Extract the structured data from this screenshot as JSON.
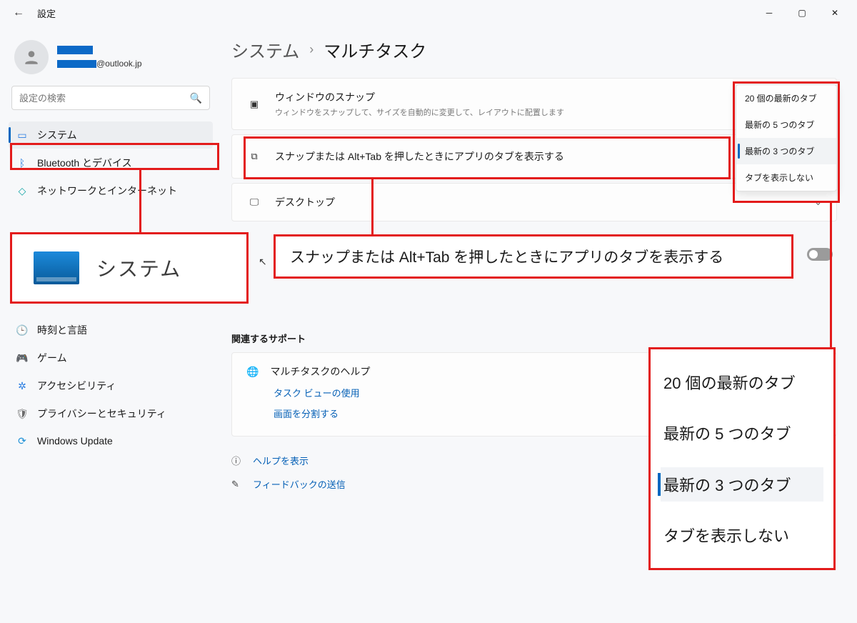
{
  "window": {
    "title": "設定"
  },
  "profile": {
    "email_suffix": "@outlook.jp"
  },
  "search": {
    "placeholder": "設定の検索"
  },
  "sidebar": {
    "items": [
      {
        "label": "システム",
        "icon": "💻",
        "cls": "i-blue"
      },
      {
        "label": "Bluetooth とデバイス",
        "icon": "ᛒ",
        "cls": "i-blue"
      },
      {
        "label": "ネットワークとインターネット",
        "icon": "◆",
        "cls": "i-teal"
      },
      {
        "label": "時刻と言語",
        "icon": "🕒",
        "cls": "i-ora"
      },
      {
        "label": "ゲーム",
        "icon": "🎮",
        "cls": "i-gray"
      },
      {
        "label": "アクセシビリティ",
        "icon": "✲",
        "cls": "i-blue"
      },
      {
        "label": "プライバシーとセキュリティ",
        "icon": "🛡",
        "cls": "i-gray"
      },
      {
        "label": "Windows Update",
        "icon": "⟳",
        "cls": "i-upd"
      }
    ]
  },
  "big_system_label": "システム",
  "breadcrumb": {
    "parent": "システム",
    "current": "マルチタスク"
  },
  "cards": {
    "snap": {
      "title": "ウィンドウのスナップ",
      "sub": "ウィンドウをスナップして、サイズを自動的に変更して、レイアウトに配置します"
    },
    "alttab": {
      "title": "スナップまたは Alt+Tab を押したときにアプリのタブを表示する"
    },
    "desktop": {
      "title": "デスクトップ"
    }
  },
  "dropdown_options": [
    "20 個の最新のタブ",
    "最新の 5 つのタブ",
    "最新の 3 つのタブ",
    "タブを表示しない"
  ],
  "big_setting_text": "スナップまたは Alt+Tab を押したときにアプリのタブを表示する",
  "section_related": "関連するサポート",
  "help": {
    "title": "マルチタスクのヘルプ",
    "links": [
      "タスク ビューの使用",
      "画面を分割する"
    ]
  },
  "bottom": {
    "help": "ヘルプを表示",
    "feedback": "フィードバックの送信"
  }
}
